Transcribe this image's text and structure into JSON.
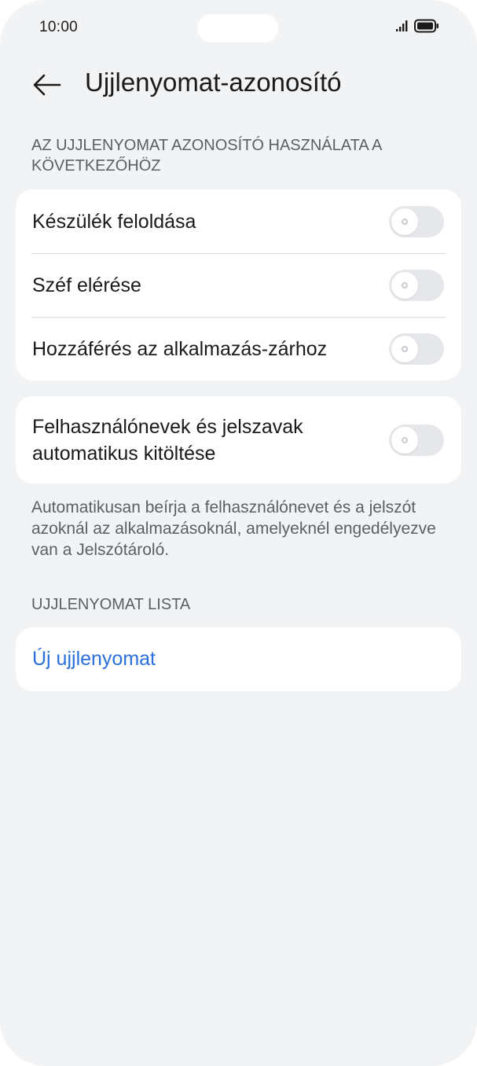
{
  "status_bar": {
    "time": "10:00"
  },
  "header": {
    "title": "Ujjlenyomat-azonosító"
  },
  "usage_section": {
    "heading": "AZ UJJLENYOMAT AZONOSÍTÓ HASZNÁLATA A KÖVETKEZŐHÖZ",
    "items": [
      {
        "label": "Készülék feloldása",
        "enabled": false
      },
      {
        "label": "Széf elérése",
        "enabled": false
      },
      {
        "label": "Hozzáférés az alkalmazás-zárhoz",
        "enabled": false
      }
    ]
  },
  "autofill": {
    "label": "Felhasználónevek és jelszavak automatikus kitöltése",
    "enabled": false,
    "description": "Automatikusan beírja a felhasználónevet és a jelszót azoknál az alkalmazásoknál, amelyeknél engedélyezve van a Jelszótároló."
  },
  "fingerprint_list": {
    "heading": "UJJLENYOMAT LISTA",
    "new_label": "Új ujjlenyomat"
  },
  "colors": {
    "background": "#f1f3f5",
    "card": "#ffffff",
    "accent": "#2a6fdb",
    "toggle_off": "#e6e7ea"
  }
}
